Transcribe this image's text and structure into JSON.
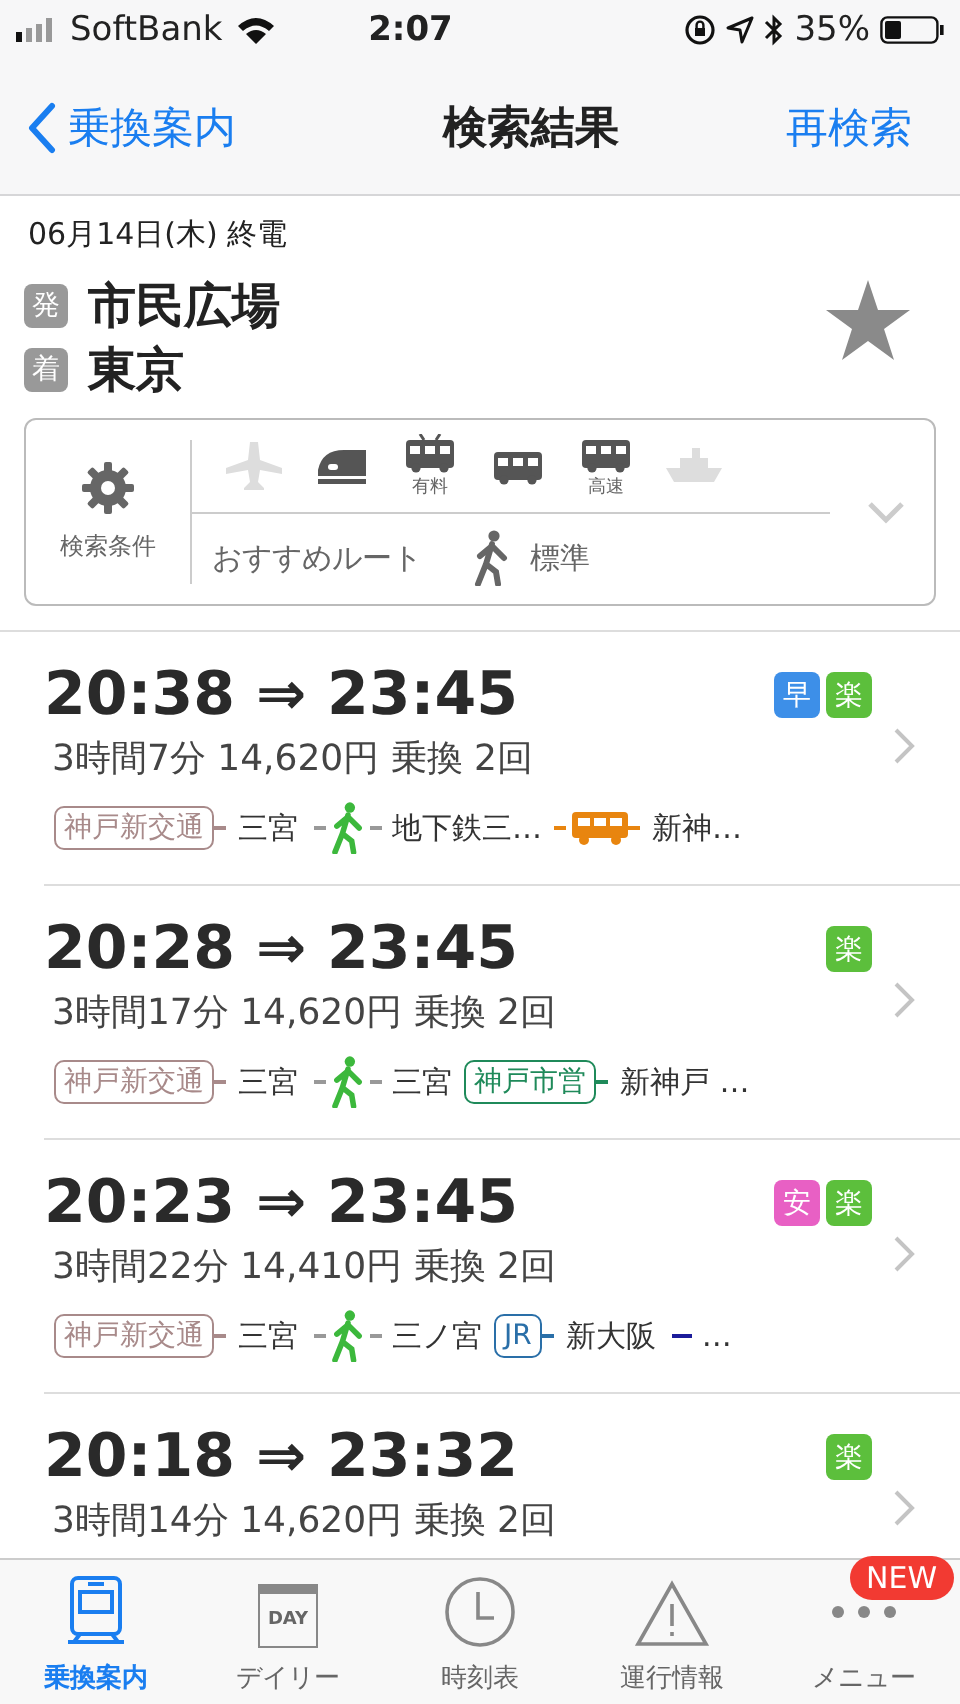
{
  "status_bar": {
    "carrier": "SoftBank",
    "time": "2:07",
    "battery": "35%"
  },
  "nav": {
    "back": "乗換案内",
    "title": "検索結果",
    "action": "再検索"
  },
  "search": {
    "date": "06月14日(木) 終電",
    "from_tag": "発",
    "from": "市民広場",
    "to_tag": "着",
    "to": "東京",
    "favorite": false
  },
  "conditions": {
    "label": "検索条件",
    "modes": [
      {
        "kind": "plane",
        "on": false
      },
      {
        "kind": "shinkansen",
        "on": true
      },
      {
        "kind": "paid-train",
        "label": "有料",
        "on": true
      },
      {
        "kind": "bus",
        "on": true
      },
      {
        "kind": "highway-bus",
        "label": "高速",
        "on": true
      },
      {
        "kind": "ship",
        "on": false
      }
    ],
    "sort": "おすすめルート",
    "walk": "標準"
  },
  "routes": [
    {
      "times": "20:38 ⇒ 23:45",
      "summary": "3時間7分 14,620円 乗換 2回",
      "badges": [
        {
          "label": "早",
          "color": "#3d8fe8"
        },
        {
          "label": "楽",
          "color": "#5cbf3c"
        }
      ],
      "segments": [
        {
          "kind": "line",
          "label": "神戸新交通",
          "color": "#a88a8a"
        },
        {
          "kind": "station",
          "label": "三宮"
        },
        {
          "kind": "walk"
        },
        {
          "kind": "station",
          "label": "地下鉄三…"
        },
        {
          "kind": "bus",
          "color": "#e8850f"
        },
        {
          "kind": "station",
          "label": "新神…"
        }
      ]
    },
    {
      "times": "20:28 ⇒ 23:45",
      "summary": "3時間17分 14,620円 乗換 2回",
      "badges": [
        {
          "label": "楽",
          "color": "#5cbf3c"
        }
      ],
      "segments": [
        {
          "kind": "line",
          "label": "神戸新交通",
          "color": "#a88a8a"
        },
        {
          "kind": "station",
          "label": "三宮"
        },
        {
          "kind": "walk"
        },
        {
          "kind": "station",
          "label": "三宮"
        },
        {
          "kind": "line",
          "label": "神戸市営",
          "color": "#1f8a5a"
        },
        {
          "kind": "station",
          "label": "新神戸 …"
        }
      ]
    },
    {
      "times": "20:23 ⇒ 23:45",
      "summary": "3時間22分 14,410円 乗換 2回",
      "badges": [
        {
          "label": "安",
          "color": "#e860c4"
        },
        {
          "label": "楽",
          "color": "#5cbf3c"
        }
      ],
      "segments": [
        {
          "kind": "line",
          "label": "神戸新交通",
          "color": "#a88a8a"
        },
        {
          "kind": "station",
          "label": "三宮"
        },
        {
          "kind": "walk"
        },
        {
          "kind": "station",
          "label": "三ノ宮"
        },
        {
          "kind": "line",
          "label": "JR",
          "color": "#2a6fa8"
        },
        {
          "kind": "station",
          "label": "新大阪"
        },
        {
          "kind": "dash",
          "color": "#1c1c9a"
        },
        {
          "kind": "station",
          "label": "…"
        }
      ]
    },
    {
      "times": "20:18 ⇒ 23:32",
      "summary": "3時間14分 14,620円 乗換 2回",
      "badges": [
        {
          "label": "楽",
          "color": "#5cbf3c"
        }
      ]
    }
  ],
  "tabs": [
    {
      "kind": "transit",
      "label": "乗換案内",
      "selected": true
    },
    {
      "kind": "daily",
      "label": "デイリー",
      "icon_text": "DAY",
      "selected": false
    },
    {
      "kind": "timetable",
      "label": "時刻表",
      "selected": false
    },
    {
      "kind": "info",
      "label": "運行情報",
      "selected": false
    },
    {
      "kind": "menu",
      "label": "メニュー",
      "badge": "NEW",
      "selected": false
    }
  ]
}
